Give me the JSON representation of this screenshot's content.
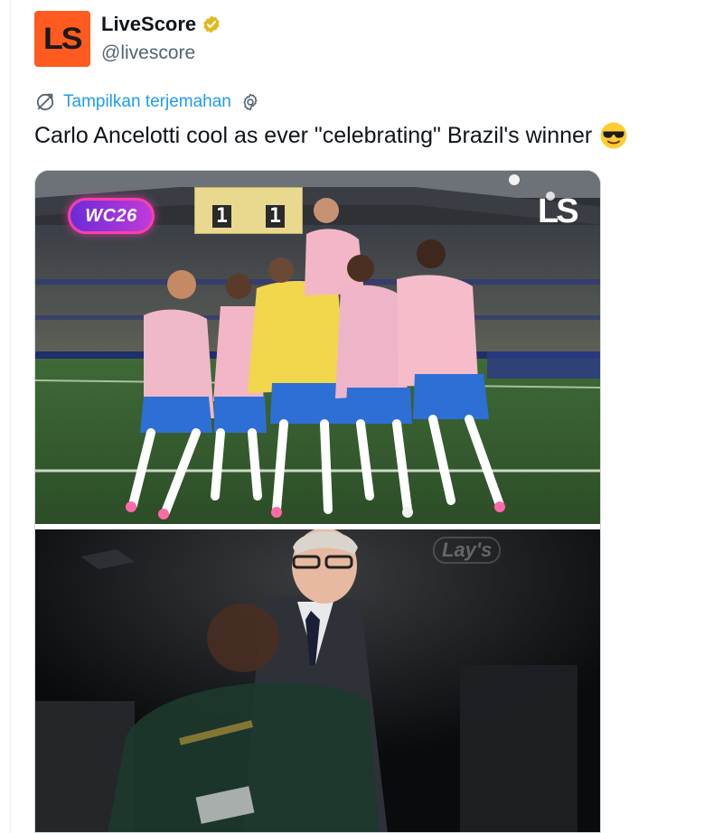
{
  "author": {
    "avatar_text": "LS",
    "display_name": "LiveScore",
    "handle": "@livescore",
    "verified_icon": "verified-badge-icon",
    "avatar_color": "#ff5a1f",
    "verified_color": "#e2b719"
  },
  "translate": {
    "icon": "translate-icon",
    "label": "Tampilkan terjemahan",
    "settings_icon": "gear-icon",
    "link_color": "#1d9bf0"
  },
  "tweet": {
    "text": "Carlo Ancelotti cool as ever \"celebrating\" Brazil's winner",
    "emoji": "smiling-face-with-sunglasses-emoji"
  },
  "media": {
    "top_photo": {
      "badge": "WC26",
      "watermark": "LS",
      "scoreboard": {
        "home": "1",
        "away": "1"
      }
    },
    "bottom_photo": {
      "sponsor_mark": "Lay's"
    }
  }
}
